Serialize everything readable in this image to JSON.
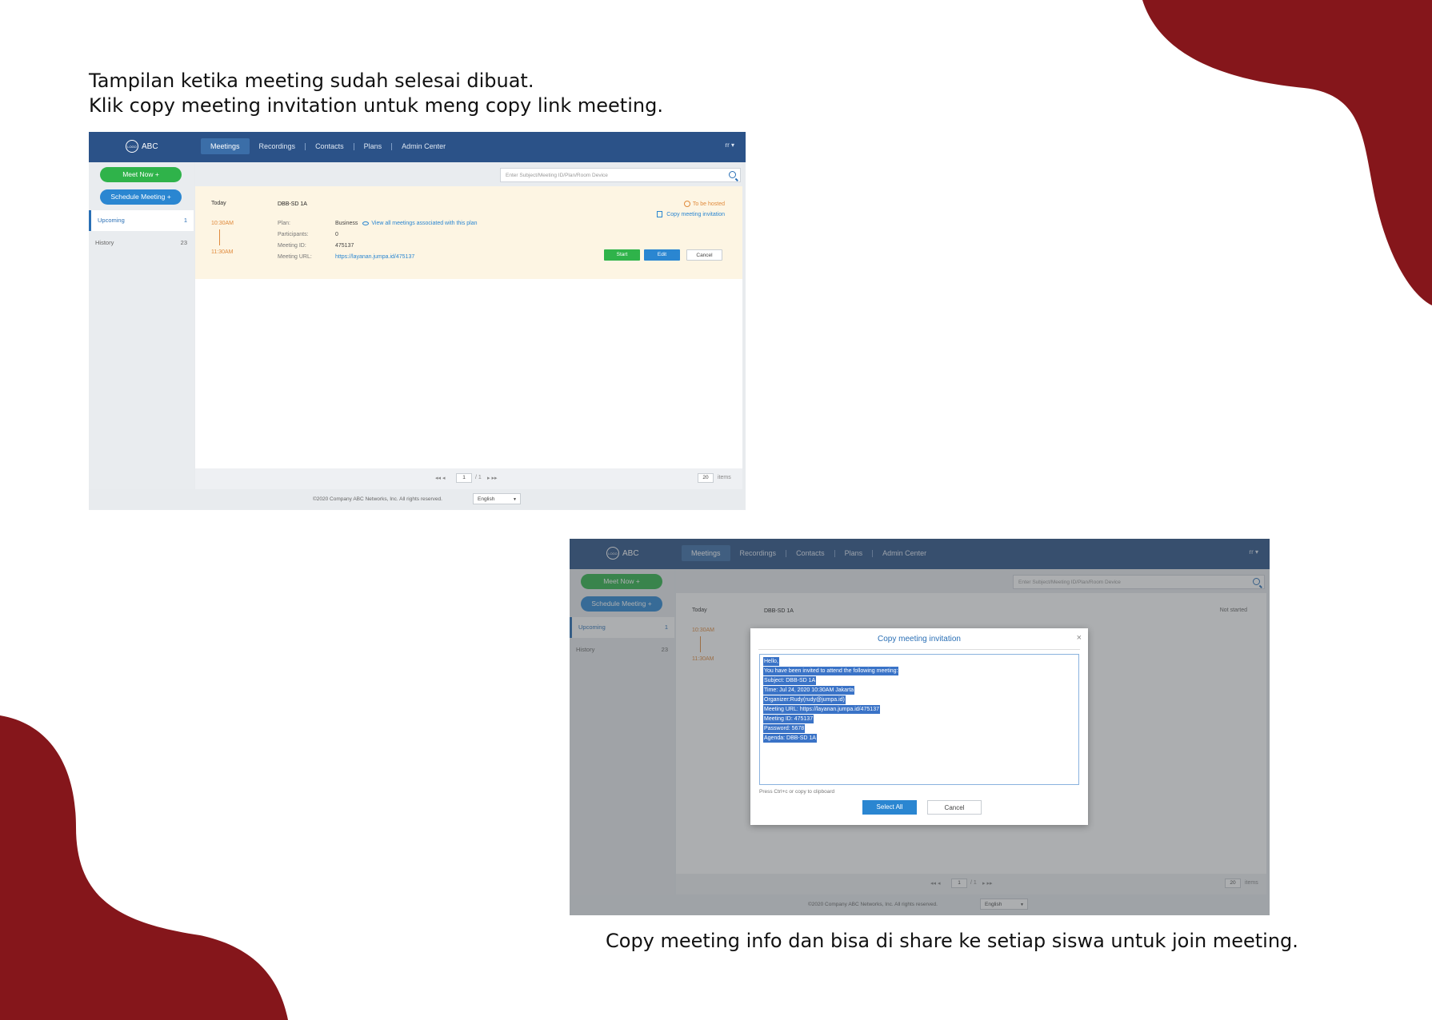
{
  "colors": {
    "brand_red": "#85161b",
    "nav_blue": "#2b5288",
    "green": "#2fb34a",
    "blue": "#2a86d1",
    "highlight": "#fdf5e3"
  },
  "caption_top": {
    "line1": "Tampilan ketika meeting sudah selesai dibuat.",
    "line2": "Klik copy meeting invitation untuk meng copy link meeting."
  },
  "caption_bottom": "Copy meeting info dan bisa di share ke setiap siswa untuk join meeting.",
  "app": {
    "logo_text": "ABC",
    "logo_badge": "LOGO",
    "nav": [
      "Meetings",
      "Recordings",
      "Contacts",
      "Plans",
      "Admin Center"
    ],
    "user_menu": "rr ▾",
    "meet_now": "Meet Now +",
    "schedule": "Schedule Meeting +",
    "sidebar": [
      {
        "label": "Upcoming",
        "count": "1"
      },
      {
        "label": "History",
        "count": "23"
      }
    ],
    "search_placeholder": "Enter Subject/Meeting ID/Plan/Room Device",
    "footer": "©2020 Company ABC Networks, Inc. All rights reserved.",
    "language": "English",
    "pager": {
      "page": "1",
      "total": "/ 1",
      "page_size": "20",
      "items_label": "items"
    }
  },
  "meeting": {
    "day": "Today",
    "title": "DBB-SD 1A",
    "start": "10:30AM",
    "end": "11:30AM",
    "plan_label": "Plan:",
    "plan_value": "Business",
    "plan_link": "View all meetings associated with this plan",
    "participants_label": "Participants:",
    "participants_value": "0",
    "id_label": "Meeting ID:",
    "id_value": "475137",
    "url_label": "Meeting URL:",
    "url_value": "https://layanan.jumpa.id/475137",
    "status": "To be hosted",
    "copy_link": "Copy meeting invitation",
    "start_btn": "Start",
    "edit_btn": "Edit",
    "cancel_btn": "Cancel",
    "status_2": "Not started"
  },
  "dialog": {
    "title": "Copy meeting invitation",
    "close": "×",
    "lines": [
      "Hello,",
      "You have been invited to attend the following meeting:",
      "Subject: DBB-SD 1A",
      "Time: Jul 24, 2020 10:30AM Jakarta",
      "Organizer:Rudy(rudy@jumpa.id)",
      "Meeting URL: https://layanan.jumpa.id/475137",
      "Meeting ID: 475137",
      "Password: 5678",
      "Agenda: DBB-SD 1A"
    ],
    "hint": "Press Ctrl+c or copy to clipboard",
    "select_all": "Select All",
    "cancel": "Cancel"
  }
}
